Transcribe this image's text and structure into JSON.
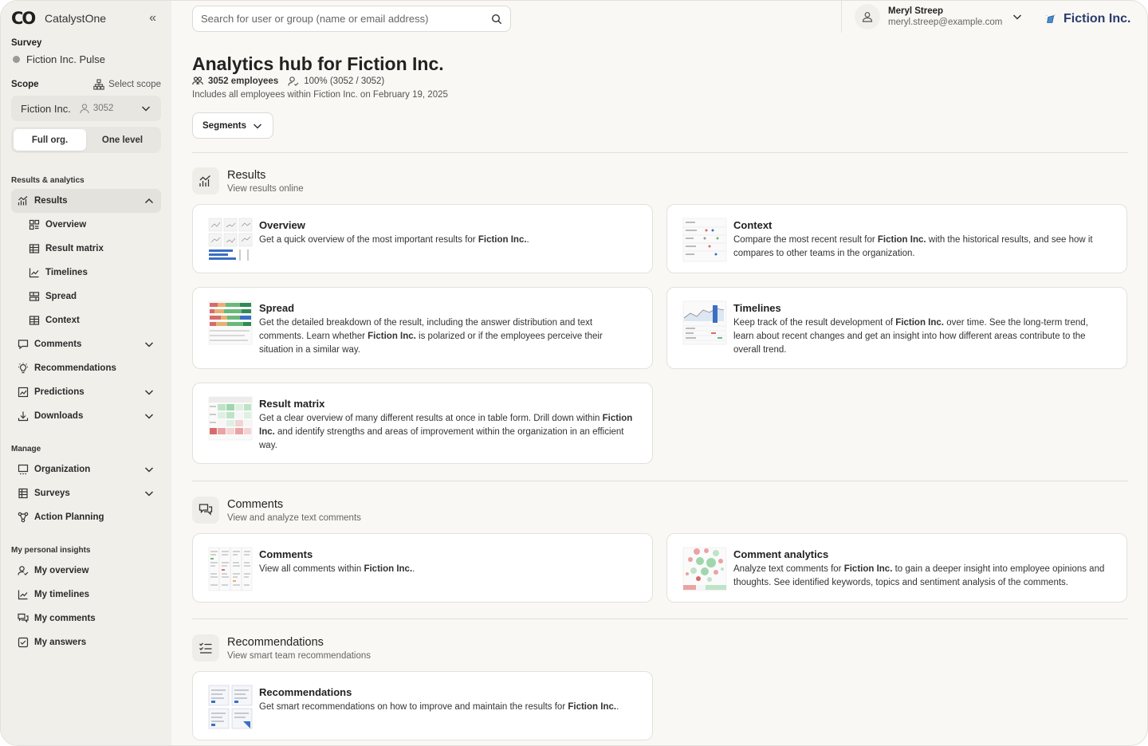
{
  "app": {
    "logo_mark": "CO",
    "name": "CatalystOne"
  },
  "sidebar": {
    "survey_label": "Survey",
    "survey_name": "Fiction Inc. Pulse",
    "scope_label": "Scope",
    "select_scope": "Select scope",
    "scope_value": "Fiction Inc.",
    "scope_count": "3052",
    "toggle": {
      "full": "Full org.",
      "one": "One level"
    },
    "groups": {
      "results_analytics": "Results & analytics",
      "manage": "Manage",
      "personal": "My personal insights"
    },
    "results": "Results",
    "results_sub": [
      "Overview",
      "Result matrix",
      "Timelines",
      "Spread",
      "Context"
    ],
    "comments": "Comments",
    "recommendations": "Recommendations",
    "predictions": "Predictions",
    "downloads": "Downloads",
    "organization": "Organization",
    "surveys": "Surveys",
    "action_planning": "Action Planning",
    "my_overview": "My overview",
    "my_timelines": "My timelines",
    "my_comments": "My comments",
    "my_answers": "My answers"
  },
  "search": {
    "placeholder": "Search for user or group (name or email address)"
  },
  "user": {
    "name": "Meryl Streep",
    "email": "meryl.streep@example.com"
  },
  "brand": {
    "name": "Fiction Inc."
  },
  "page": {
    "title": "Analytics hub for Fiction Inc.",
    "employees": "3052 employees",
    "response": "100% (3052 / 3052)",
    "includes": "Includes all employees within Fiction Inc. on February 19, 2025",
    "segments": "Segments"
  },
  "sections": {
    "results": {
      "title": "Results",
      "sub": "View results online"
    },
    "comments": {
      "title": "Comments",
      "sub": "View and analyze text comments"
    },
    "recommendations": {
      "title": "Recommendations",
      "sub": "View smart team recommendations"
    }
  },
  "cards": {
    "overview": {
      "title": "Overview",
      "d1": "Get a quick overview of the most important results for ",
      "b1": "Fiction Inc.",
      "d2": "."
    },
    "context": {
      "title": "Context",
      "d1": "Compare the most recent result for ",
      "b1": "Fiction Inc.",
      "d2": " with the historical results, and see how it compares to other teams in the organization."
    },
    "spread": {
      "title": "Spread",
      "d1": "Get the detailed breakdown of the result, including the answer distribution and text comments. Learn whether ",
      "b1": "Fiction Inc.",
      "d2": " is polarized or if the employees perceive their situation in a similar way."
    },
    "timelines": {
      "title": "Timelines",
      "d1": "Keep track of the result development of ",
      "b1": "Fiction Inc.",
      "d2": " over time. See the long-term trend, learn about recent changes and get an insight into how different areas contribute to the overall trend."
    },
    "result_matrix": {
      "title": "Result matrix",
      "d1": "Get a clear overview of many different results at once in table form. Drill down within ",
      "b1": "Fiction Inc.",
      "d2": " and identify strengths and areas of improvement within the organization in an efficient way."
    },
    "comments": {
      "title": "Comments",
      "d1": "View all comments within ",
      "b1": "Fiction Inc.",
      "d2": "."
    },
    "comment_analytics": {
      "title": "Comment analytics",
      "d1": "Analyze text comments for ",
      "b1": "Fiction Inc.",
      "d2": " to gain a deeper insight into employee opinions and thoughts. See identified keywords, topics and sentiment analysis of the comments."
    },
    "recommendations": {
      "title": "Recommendations",
      "d1": "Get smart recommendations on how to improve and maintain the results for ",
      "b1": "Fiction Inc.",
      "d2": "."
    }
  }
}
